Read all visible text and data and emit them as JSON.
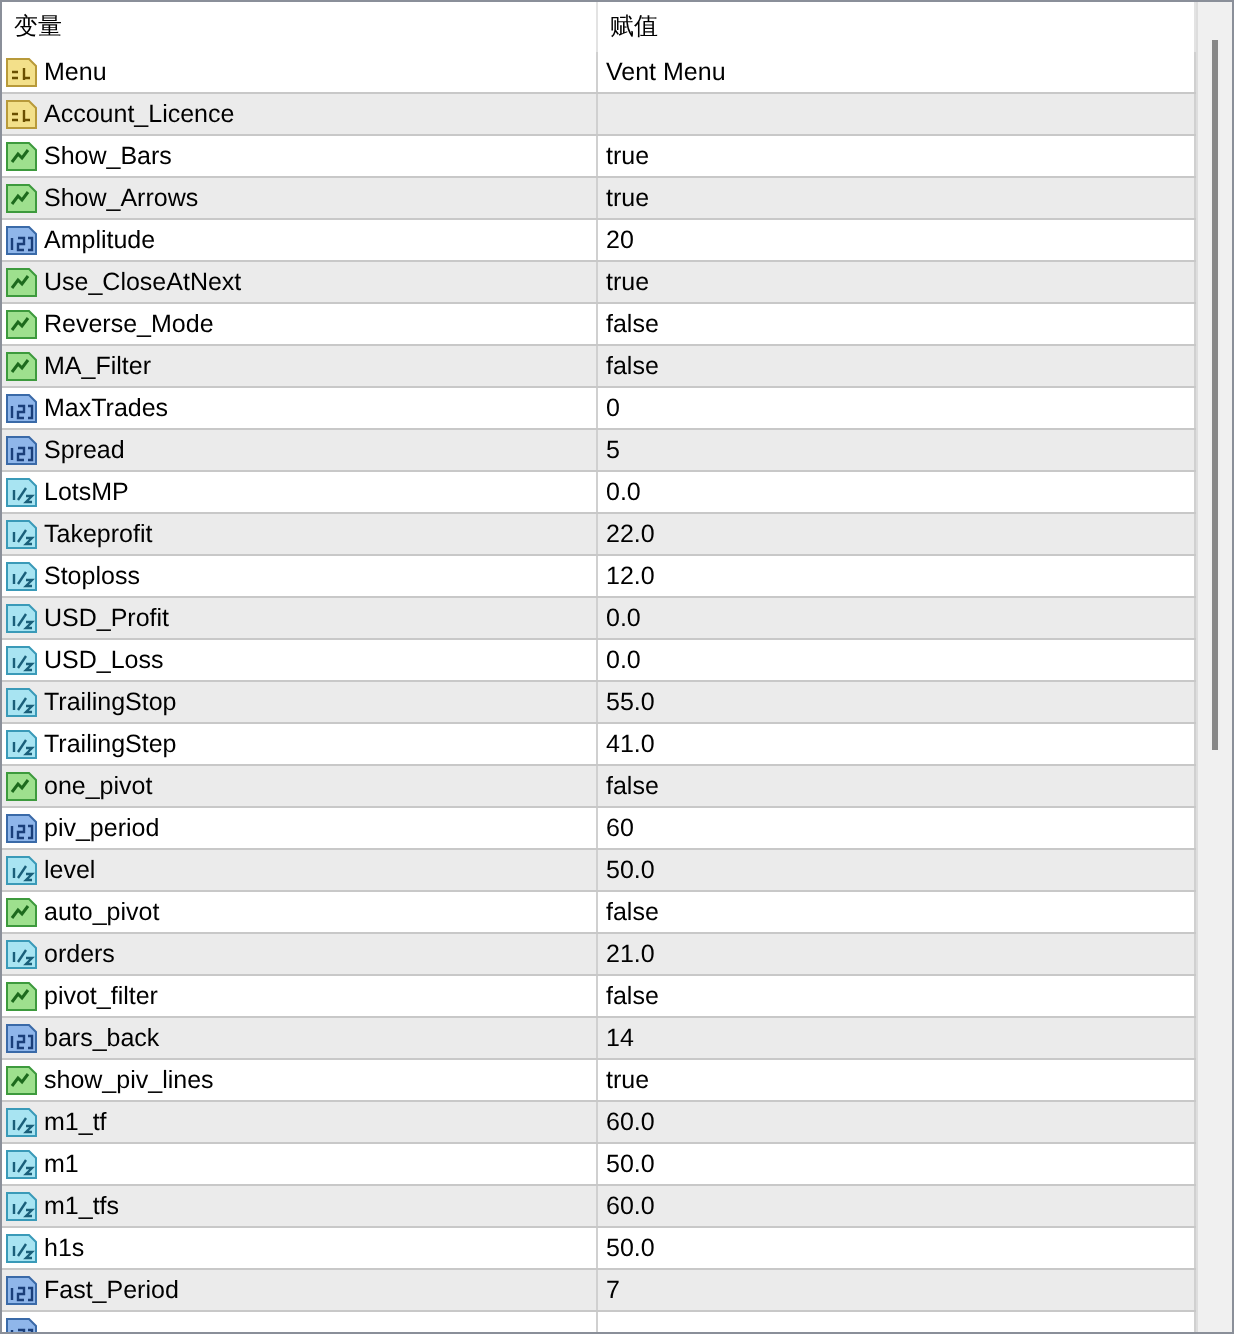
{
  "table": {
    "columns": [
      "变量",
      "赋值"
    ],
    "rows": [
      {
        "kind": "string",
        "name": "Menu",
        "value": "Vent Menu"
      },
      {
        "kind": "string",
        "name": "Account_Licence",
        "value": ""
      },
      {
        "kind": "bool",
        "name": "Show_Bars",
        "value": "true"
      },
      {
        "kind": "bool",
        "name": "Show_Arrows",
        "value": "true"
      },
      {
        "kind": "int",
        "name": "Amplitude",
        "value": "20"
      },
      {
        "kind": "bool",
        "name": "Use_CloseAtNext",
        "value": "true"
      },
      {
        "kind": "bool",
        "name": "Reverse_Mode",
        "value": "false"
      },
      {
        "kind": "bool",
        "name": "MA_Filter",
        "value": "false"
      },
      {
        "kind": "int",
        "name": "MaxTrades",
        "value": "0"
      },
      {
        "kind": "int",
        "name": "Spread",
        "value": "5"
      },
      {
        "kind": "double",
        "name": "LotsMP",
        "value": "0.0"
      },
      {
        "kind": "double",
        "name": "Takeprofit",
        "value": "22.0"
      },
      {
        "kind": "double",
        "name": "Stoploss",
        "value": "12.0"
      },
      {
        "kind": "double",
        "name": "USD_Profit",
        "value": "0.0"
      },
      {
        "kind": "double",
        "name": "USD_Loss",
        "value": "0.0"
      },
      {
        "kind": "double",
        "name": "TrailingStop",
        "value": "55.0"
      },
      {
        "kind": "double",
        "name": "TrailingStep",
        "value": "41.0"
      },
      {
        "kind": "bool",
        "name": "one_pivot",
        "value": "false"
      },
      {
        "kind": "int",
        "name": "piv_period",
        "value": "60"
      },
      {
        "kind": "double",
        "name": "level",
        "value": "50.0"
      },
      {
        "kind": "bool",
        "name": "auto_pivot",
        "value": "false"
      },
      {
        "kind": "double",
        "name": "orders",
        "value": "21.0"
      },
      {
        "kind": "bool",
        "name": "pivot_filter",
        "value": "false"
      },
      {
        "kind": "int",
        "name": "bars_back",
        "value": "14"
      },
      {
        "kind": "bool",
        "name": "show_piv_lines",
        "value": "true"
      },
      {
        "kind": "double",
        "name": "m1_tf",
        "value": "60.0"
      },
      {
        "kind": "double",
        "name": "m1",
        "value": "50.0"
      },
      {
        "kind": "double",
        "name": "m1_tfs",
        "value": "60.0"
      },
      {
        "kind": "double",
        "name": "h1s",
        "value": "50.0"
      },
      {
        "kind": "int",
        "name": "Fast_Period",
        "value": "7"
      },
      {
        "kind": "int",
        "name": "",
        "value": ""
      }
    ]
  }
}
